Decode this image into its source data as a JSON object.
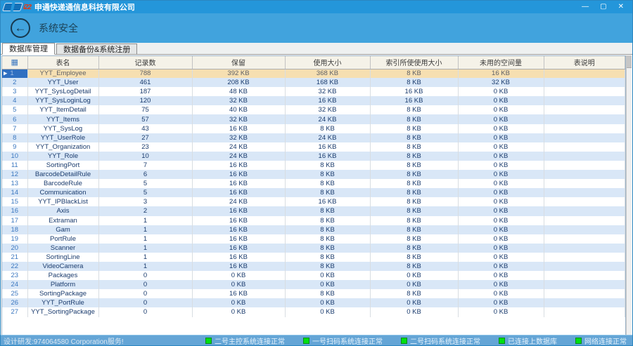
{
  "window": {
    "title": "申通快递通信息科技有限公司",
    "controls": {
      "minimize": "—",
      "maximize": "▢",
      "close": "✕"
    }
  },
  "page": {
    "title": "系统安全"
  },
  "icons": {
    "back_arrow": "←",
    "header_grid_icon": "▦",
    "selection_arrow": "▶"
  },
  "tabs": [
    {
      "label": "数据库管理",
      "active": true
    },
    {
      "label": "数据备份&系统注册",
      "active": false
    }
  ],
  "table": {
    "headers": [
      "",
      "表名",
      "记录数",
      "保留",
      "使用大小",
      "索引所使使用大小",
      "未用的空间量",
      "表说明"
    ],
    "selected_row_index": 0,
    "rows": [
      [
        "1",
        "YYT_Employee",
        "788",
        "392 KB",
        "368 KB",
        "8 KB",
        "16 KB",
        ""
      ],
      [
        "2",
        "YYT_User",
        "461",
        "208 KB",
        "168 KB",
        "8 KB",
        "32 KB",
        ""
      ],
      [
        "3",
        "YYT_SysLogDetail",
        "187",
        "48 KB",
        "32 KB",
        "16 KB",
        "0 KB",
        ""
      ],
      [
        "4",
        "YYT_SysLoginLog",
        "120",
        "32 KB",
        "16 KB",
        "16 KB",
        "0 KB",
        ""
      ],
      [
        "5",
        "YYT_ItemDetail",
        "75",
        "40 KB",
        "32 KB",
        "8 KB",
        "0 KB",
        ""
      ],
      [
        "6",
        "YYT_Items",
        "57",
        "32 KB",
        "24 KB",
        "8 KB",
        "0 KB",
        ""
      ],
      [
        "7",
        "YYT_SysLog",
        "43",
        "16 KB",
        "8 KB",
        "8 KB",
        "0 KB",
        ""
      ],
      [
        "8",
        "YYT_UserRole",
        "27",
        "32 KB",
        "24 KB",
        "8 KB",
        "0 KB",
        ""
      ],
      [
        "9",
        "YYT_Organization",
        "23",
        "24 KB",
        "16 KB",
        "8 KB",
        "0 KB",
        ""
      ],
      [
        "10",
        "YYT_Role",
        "10",
        "24 KB",
        "16 KB",
        "8 KB",
        "0 KB",
        ""
      ],
      [
        "11",
        "SortingPort",
        "7",
        "16 KB",
        "8 KB",
        "8 KB",
        "0 KB",
        ""
      ],
      [
        "12",
        "BarcodeDetailRule",
        "6",
        "16 KB",
        "8 KB",
        "8 KB",
        "0 KB",
        ""
      ],
      [
        "13",
        "BarcodeRule",
        "5",
        "16 KB",
        "8 KB",
        "8 KB",
        "0 KB",
        ""
      ],
      [
        "14",
        "Communication",
        "5",
        "16 KB",
        "8 KB",
        "8 KB",
        "0 KB",
        ""
      ],
      [
        "15",
        "YYT_IPBlackList",
        "3",
        "24 KB",
        "16 KB",
        "8 KB",
        "0 KB",
        ""
      ],
      [
        "16",
        "Axis",
        "2",
        "16 KB",
        "8 KB",
        "8 KB",
        "0 KB",
        ""
      ],
      [
        "17",
        "Extraman",
        "1",
        "16 KB",
        "8 KB",
        "8 KB",
        "0 KB",
        ""
      ],
      [
        "18",
        "Gam",
        "1",
        "16 KB",
        "8 KB",
        "8 KB",
        "0 KB",
        ""
      ],
      [
        "19",
        "PortRule",
        "1",
        "16 KB",
        "8 KB",
        "8 KB",
        "0 KB",
        ""
      ],
      [
        "20",
        "Scanner",
        "1",
        "16 KB",
        "8 KB",
        "8 KB",
        "0 KB",
        ""
      ],
      [
        "21",
        "SortingLine",
        "1",
        "16 KB",
        "8 KB",
        "8 KB",
        "0 KB",
        ""
      ],
      [
        "22",
        "VideoCamera",
        "1",
        "16 KB",
        "8 KB",
        "8 KB",
        "0 KB",
        ""
      ],
      [
        "23",
        "Packages",
        "0",
        "0 KB",
        "0 KB",
        "0 KB",
        "0 KB",
        ""
      ],
      [
        "24",
        "Platform",
        "0",
        "0 KB",
        "0 KB",
        "0 KB",
        "0 KB",
        ""
      ],
      [
        "25",
        "SortingPackage",
        "0",
        "16 KB",
        "8 KB",
        "8 KB",
        "0 KB",
        ""
      ],
      [
        "26",
        "YYT_PortRule",
        "0",
        "0 KB",
        "0 KB",
        "0 KB",
        "0 KB",
        ""
      ],
      [
        "27",
        "YYT_SortingPackage",
        "0",
        "0 KB",
        "0 KB",
        "0 KB",
        "0 KB",
        ""
      ]
    ]
  },
  "statusbar": {
    "left_text": "设计研发:974064580 Corporation服务!",
    "indicator_color": "#00e010",
    "items": [
      {
        "label": "二号主控系统连接正常"
      },
      {
        "label": "一号扫码系统连接正常"
      },
      {
        "label": "二号扫码系统连接正常"
      },
      {
        "label": "已连接上数据库"
      },
      {
        "label": "网络连接正常"
      }
    ]
  },
  "colors": {
    "titlebar": "#2496da",
    "page_header": "#41a3dd",
    "selected_row": "#f6dfb1",
    "alt_row": "#d9e7f7",
    "statusbar": "#64a5d6",
    "indicator_green": "#00e010"
  }
}
